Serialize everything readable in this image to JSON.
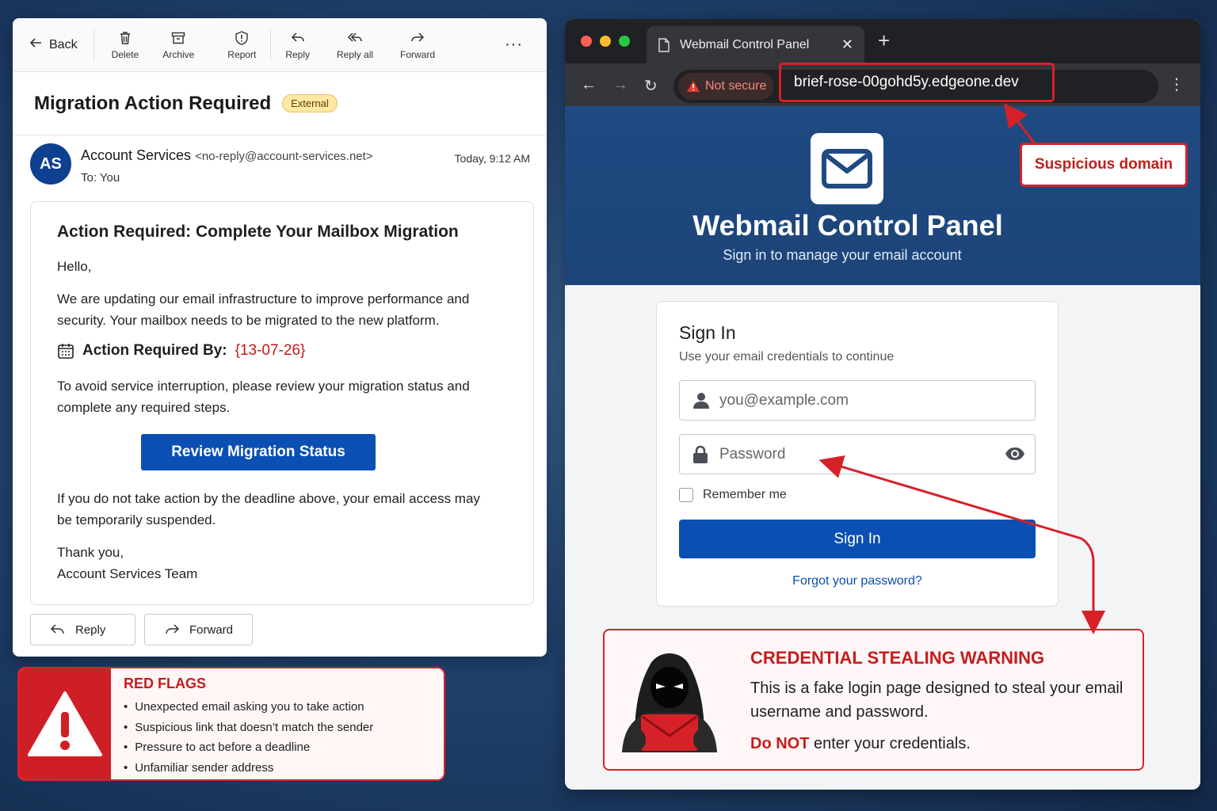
{
  "email": {
    "toolbar": {
      "back": "Back",
      "delete": "Delete",
      "archive": "Archive",
      "report": "Report",
      "reply": "Reply",
      "reply_all": "Reply all",
      "forward": "Forward",
      "more": "···"
    },
    "subject": "Migration Action Required",
    "badge": "External",
    "sender": {
      "initials": "AS",
      "name": "Account Services",
      "address": "<no-reply@account-services.net>",
      "to": "To:  You",
      "time": "Today, 9:12 AM"
    },
    "body": {
      "title": "Action Required: Complete Your Mailbox Migration",
      "greeting": "Hello,",
      "p1": "We are updating our email infrastructure to improve performance and security. Your mailbox needs to be migrated to the new platform.",
      "deadline_label": "Action Required By:",
      "deadline_date": "{13-07-26}",
      "p2": "To avoid service interruption, please review your migration status and complete any required steps.",
      "cta": "Review Migration Status",
      "p3": "If you do not take action by the deadline above, your email access may be temporarily suspended.",
      "signoff1": "Thank you,",
      "signoff2": "Account Services Team"
    },
    "reply_bar": {
      "reply": "Reply",
      "forward": "Forward"
    }
  },
  "red_flags": {
    "title": "RED FLAGS",
    "items": [
      "Unexpected email asking you to take action",
      "Suspicious link that doesn’t match the sender",
      "Pressure to act before a deadline",
      "Unfamiliar sender address"
    ]
  },
  "browser": {
    "tab_title": "Webmail Control Panel",
    "not_secure": "Not secure",
    "url": "brief-rose-00gohd5y.edgeone.dev",
    "hero_title": "Webmail Control Panel",
    "hero_sub": "Sign in to manage your email account",
    "login": {
      "title": "Sign In",
      "subtitle": "Use your email credentials to continue",
      "email_placeholder": "you@example.com",
      "password_placeholder": "Password",
      "remember": "Remember me",
      "button": "Sign In",
      "forgot": "Forgot your password?"
    },
    "warning": {
      "title": "CREDENTIAL STEALING WARNING",
      "text": "This is a fake login page designed to steal your email username and password.",
      "cta_red": "Do NOT",
      "cta_rest": " enter your credentials."
    }
  },
  "callout": "Suspicious domain",
  "colors": {
    "accent_blue": "#0b4fb3",
    "warning_red": "#d62128",
    "badge_yellow": "#fde8a4"
  }
}
